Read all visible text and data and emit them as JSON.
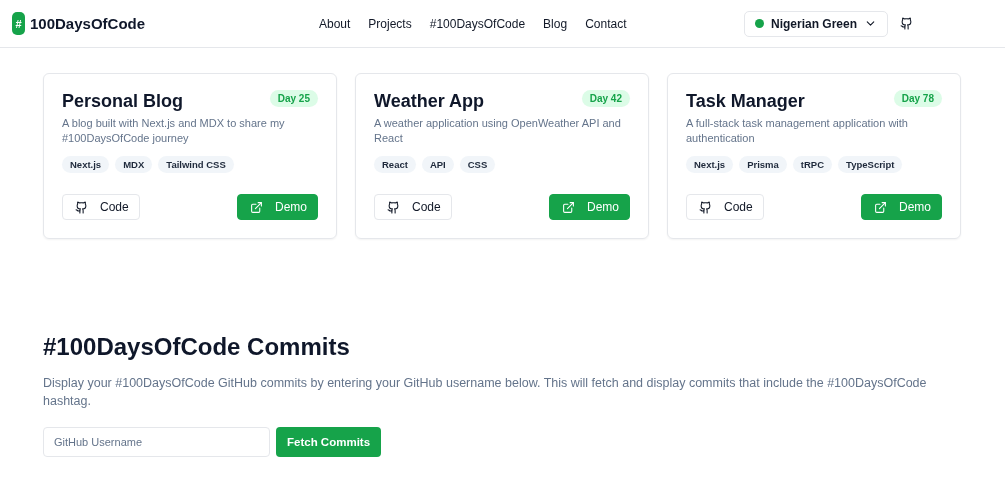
{
  "header": {
    "logo_mark": "#",
    "logo_text": "100DaysOfCode",
    "nav": [
      {
        "label": "About"
      },
      {
        "label": "Projects"
      },
      {
        "label": "#100DaysOfCode"
      },
      {
        "label": "Blog"
      },
      {
        "label": "Contact"
      }
    ],
    "theme_select": {
      "value": "Nigerian Green",
      "color": "#16a34a"
    }
  },
  "projects_section": {
    "cards": [
      {
        "title": "Personal Blog",
        "badge": "Day 25",
        "description": "A blog built with Next.js and MDX to share my #100DaysOfCode journey",
        "tags": [
          "Next.js",
          "MDX",
          "Tailwind CSS"
        ],
        "code_button": "Code",
        "demo_button": "Demo"
      },
      {
        "title": "Weather App",
        "badge": "Day 42",
        "description": "A weather application using OpenWeather API and React",
        "tags": [
          "React",
          "API",
          "CSS"
        ],
        "code_button": "Code",
        "demo_button": "Demo"
      },
      {
        "title": "Task Manager",
        "badge": "Day 78",
        "description": "A full-stack task management application with authentication",
        "tags": [
          "Next.js",
          "Prisma",
          "tRPC",
          "TypeScript"
        ],
        "code_button": "Code",
        "demo_button": "Demo"
      }
    ]
  },
  "commits_section": {
    "title": "#100DaysOfCode Commits",
    "description": "Display your #100DaysOfCode GitHub commits by entering your GitHub username below. This will fetch and display commits that include the #100DaysOfCode hashtag.",
    "username_field": {
      "placeholder": "GitHub Username"
    },
    "fetch_button": "Fetch Commits"
  }
}
